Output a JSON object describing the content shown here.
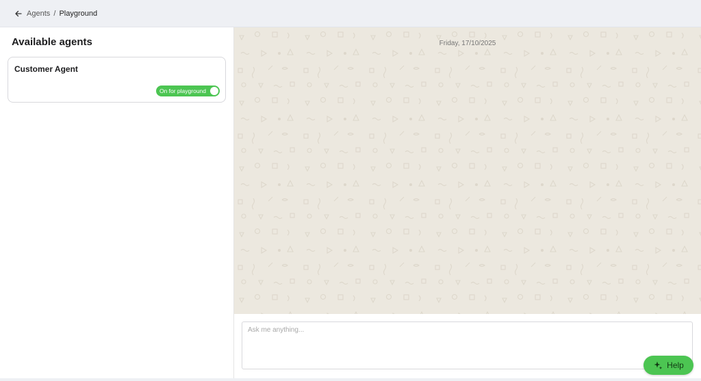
{
  "header": {
    "back_icon": "arrow-left-icon",
    "breadcrumb": {
      "parent": "Agents",
      "separator": "/",
      "current": "Playground"
    }
  },
  "sidebar": {
    "title": "Available agents",
    "agents": [
      {
        "name": "Customer Agent",
        "toggle_label": "On for playground",
        "toggle_on": true
      }
    ]
  },
  "chat": {
    "date_label": "Friday, 17/10/2025",
    "input_placeholder": "Ask me anything...",
    "input_value": ""
  },
  "help": {
    "label": "Help",
    "icon": "sparkle-icon"
  },
  "colors": {
    "accent_green": "#4cc552",
    "chat_background": "#ece8df"
  }
}
